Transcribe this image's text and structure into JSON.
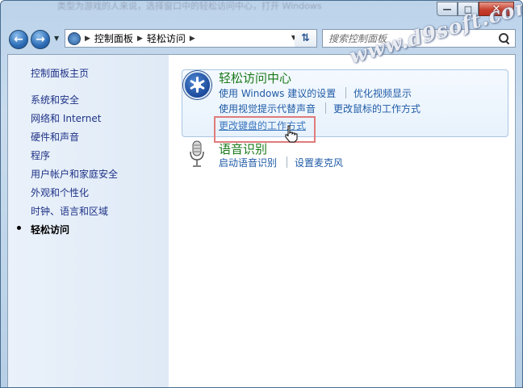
{
  "window": {
    "background_text": "类型为游戏的人来说，选择窗口中的轻松访问中心，打开 Windows"
  },
  "nav": {
    "breadcrumbs": [
      "控制面板",
      "轻松访问"
    ],
    "search_placeholder": "搜索控制面板"
  },
  "sidebar": {
    "items": [
      {
        "label": "控制面板主页"
      },
      {
        "label": "系统和安全"
      },
      {
        "label": "网络和 Internet"
      },
      {
        "label": "硬件和声音"
      },
      {
        "label": "程序"
      },
      {
        "label": "用户帐户和家庭安全"
      },
      {
        "label": "外观和个性化"
      },
      {
        "label": "时钟、语言和区域"
      },
      {
        "label": "轻松访问"
      }
    ],
    "active_index": 8
  },
  "main": {
    "ease_center": {
      "title": "轻松访问中心",
      "links": [
        "使用 Windows 建议的设置",
        "优化视频显示",
        "使用视觉提示代替声音",
        "更改鼠标的工作方式",
        "更改键盘的工作方式"
      ]
    },
    "speech": {
      "title": "语音识别",
      "links": [
        "启动语音识别",
        "设置麦克风"
      ]
    }
  },
  "watermark": "www.d9soft.com",
  "colors": {
    "category_title": "#1a7a1a",
    "link": "#1f5ba6",
    "highlight_box": "#e07b7b"
  }
}
